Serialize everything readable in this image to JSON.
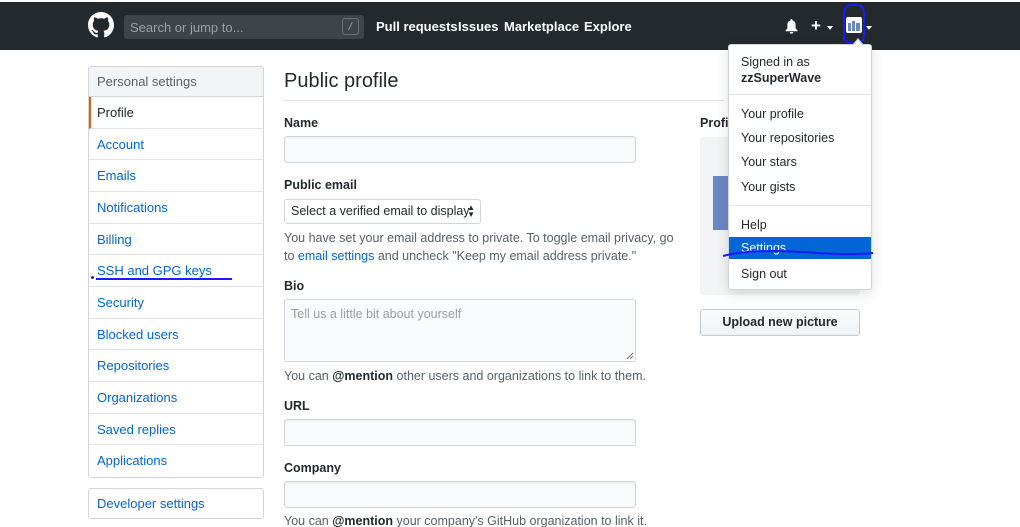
{
  "header": {
    "search": {
      "placeholder": "Search or jump to...",
      "shortcut": "/"
    },
    "nav": [
      "Pull requests",
      "Issues",
      "Marketplace",
      "Explore"
    ],
    "icons": [
      "github-logo-icon",
      "bell-icon",
      "plus-icon",
      "avatar"
    ]
  },
  "sidebar": {
    "heading": "Personal settings",
    "items": [
      {
        "label": "Profile",
        "active": true
      },
      {
        "label": "Account"
      },
      {
        "label": "Emails"
      },
      {
        "label": "Notifications"
      },
      {
        "label": "Billing"
      },
      {
        "label": "SSH and GPG keys"
      },
      {
        "label": "Security"
      },
      {
        "label": "Blocked users"
      },
      {
        "label": "Repositories"
      },
      {
        "label": "Organizations"
      },
      {
        "label": "Saved replies"
      },
      {
        "label": "Applications"
      }
    ],
    "developer": "Developer settings"
  },
  "main": {
    "title": "Public profile",
    "name_label": "Name",
    "email_label": "Public email",
    "email_select": "Select a verified email to display",
    "email_note_1": "You have set your email address to private. To toggle email privacy, go",
    "email_note_to": "to",
    "email_note_link": "email settings",
    "email_note_2": "and uncheck \"Keep my email address private.\"",
    "bio_label": "Bio",
    "bio_placeholder": "Tell us a little bit about yourself",
    "bio_note_1": "You can",
    "bio_note_mention": "@mention",
    "bio_note_2": "other users and organizations to link to them.",
    "url_label": "URL",
    "company_label": "Company",
    "company_note_1": "You can",
    "company_note_mention": "@mention",
    "company_note_2": "your company's GitHub organization to link it."
  },
  "picture": {
    "label": "Profil",
    "upload": "Upload new picture"
  },
  "dropdown": {
    "signed_in": "Signed in as",
    "username": "zzSuperWave",
    "items": [
      "Your profile",
      "Your repositories",
      "Your stars",
      "Your gists",
      "Help",
      "Settings",
      "Sign out"
    ],
    "selected": "Settings"
  },
  "colors": {
    "header_bg": "#24292e",
    "link": "#0366d6",
    "accent_active": "#e36209",
    "annotation": "#1a1aff"
  }
}
